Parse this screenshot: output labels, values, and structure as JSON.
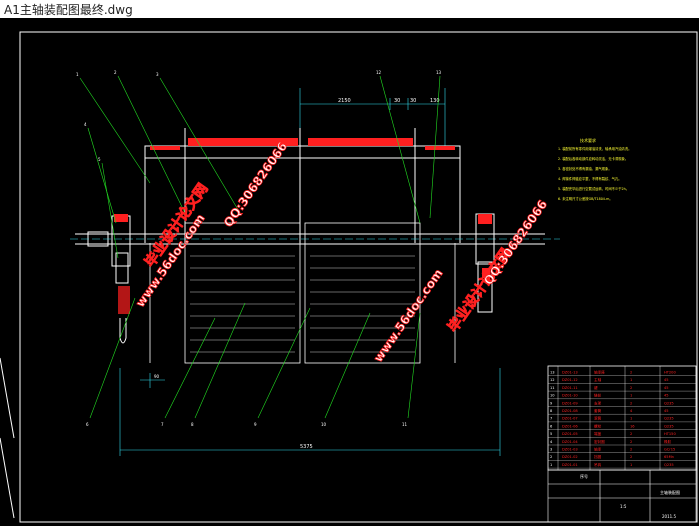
{
  "window": {
    "title": "A1主轴装配图最终.dwg"
  },
  "drawing": {
    "dimensions": {
      "top_left": "2150",
      "top_mid1": "30",
      "top_mid2": "30",
      "top_right": "130",
      "bottom_overall": "5375",
      "left_small": "90"
    },
    "leader_numbers": [
      "1",
      "2",
      "3",
      "4",
      "5",
      "6",
      "7",
      "8",
      "9",
      "10",
      "11",
      "12",
      "13"
    ],
    "notes_title": "技术要求",
    "notes_lines": [
      "1. 装配前所有零件用煤油清洗，轴承用汽油清洗。",
      "2. 装配后各转动部件应转动灵活，无卡滞现象。",
      "3. 各密封处不得有漏油、漏气现象。",
      "4. 焊接件焊缝应平整，不得有裂纹、气孔。",
      "5. 装配完毕后进行空载试运转，时间不少于2h。",
      "6. 未注明尺寸公差按GB/T1804-m。"
    ],
    "bom_rows": [
      {
        "no": "13",
        "code": "DZ01-13",
        "name": "轴承座",
        "qty": "2",
        "mat": "HT200"
      },
      {
        "no": "12",
        "code": "DZ01-12",
        "name": "主轴",
        "qty": "1",
        "mat": "45"
      },
      {
        "no": "11",
        "code": "DZ01-11",
        "name": "键",
        "qty": "2",
        "mat": "45"
      },
      {
        "no": "10",
        "code": "DZ01-10",
        "name": "链轮",
        "qty": "1",
        "mat": "45"
      },
      {
        "no": "9",
        "code": "DZ01-09",
        "name": "支架",
        "qty": "2",
        "mat": "Q235"
      },
      {
        "no": "8",
        "code": "DZ01-08",
        "name": "套筒",
        "qty": "4",
        "mat": "45"
      },
      {
        "no": "7",
        "code": "DZ01-07",
        "name": "滚筒",
        "qty": "1",
        "mat": "Q235"
      },
      {
        "no": "6",
        "code": "DZ01-06",
        "name": "螺栓",
        "qty": "16",
        "mat": "Q235"
      },
      {
        "no": "5",
        "code": "DZ01-05",
        "name": "端盖",
        "qty": "2",
        "mat": "HT150"
      },
      {
        "no": "4",
        "code": "DZ01-04",
        "name": "密封圈",
        "qty": "2",
        "mat": "橡胶"
      },
      {
        "no": "3",
        "code": "DZ01-03",
        "name": "轴承",
        "qty": "2",
        "mat": "GCr15"
      },
      {
        "no": "2",
        "code": "DZ01-02",
        "name": "挡圈",
        "qty": "2",
        "mat": "65Mn"
      },
      {
        "no": "1",
        "code": "DZ01-01",
        "name": "吊钩",
        "qty": "1",
        "mat": "Q235"
      }
    ],
    "bom_header": {
      "no": "序号",
      "code": "代号",
      "name": "名称",
      "qty": "数量",
      "mat": "材料"
    },
    "title_block": {
      "drawing_name": "主轴装配图",
      "scale": "1:5",
      "sheet": "2011.5"
    }
  },
  "watermarks": [
    {
      "text": "毕业设计论文网"
    },
    {
      "text": "www.56doc.com"
    },
    {
      "text": "QQ:306826066"
    },
    {
      "text": "毕业设计论文网"
    },
    {
      "text": "www.56doc.com"
    },
    {
      "text": "QQ:306826066"
    }
  ],
  "colors": {
    "background": "#000000",
    "line_white": "#ffffff",
    "line_green": "#22dd22",
    "line_cyan": "#33ddee",
    "red": "#ff2020",
    "yellow": "#ffff33"
  }
}
